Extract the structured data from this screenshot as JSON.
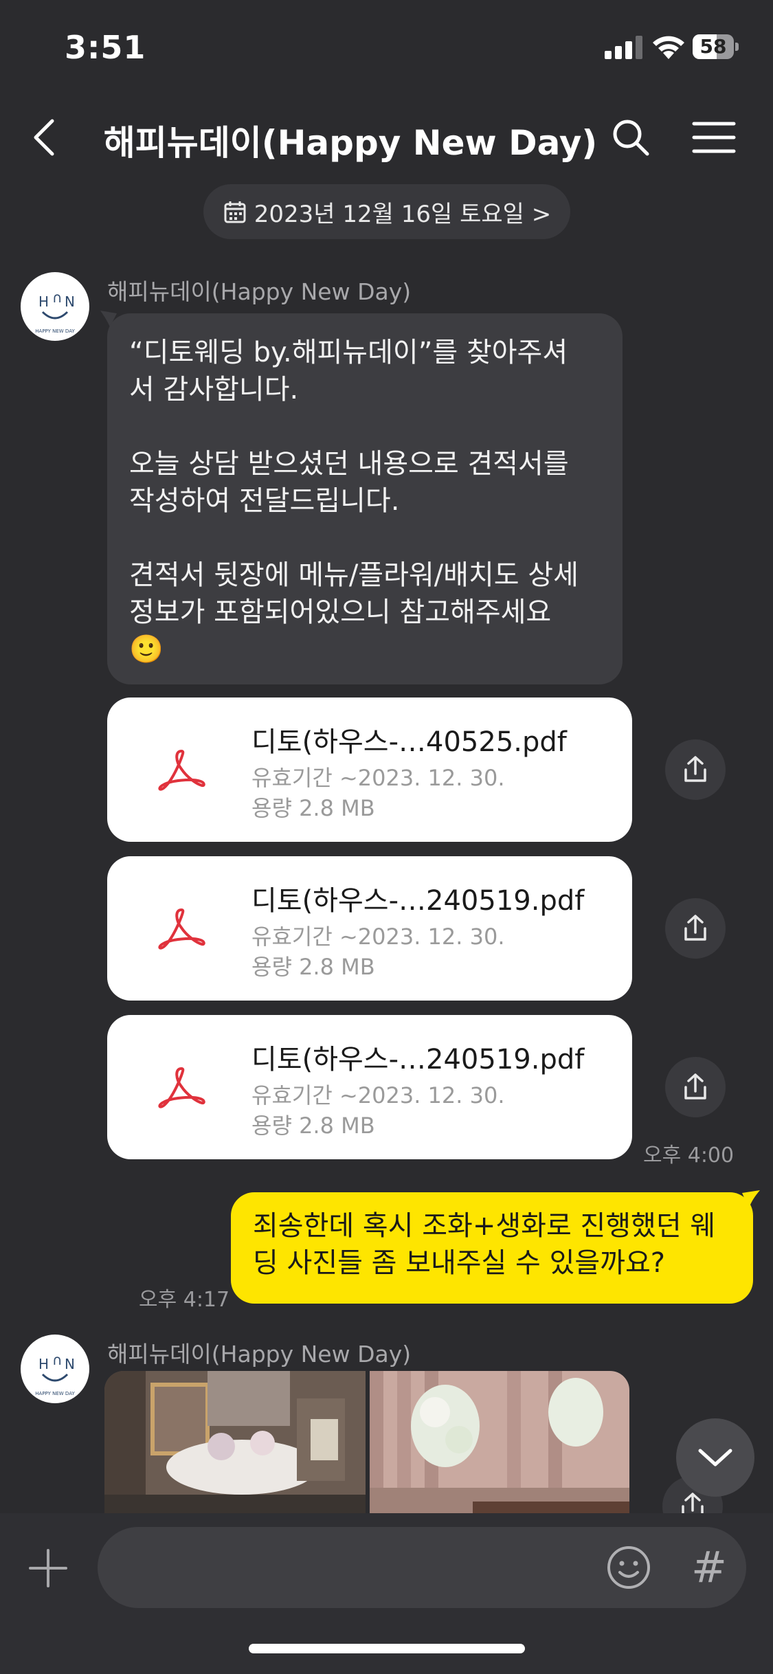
{
  "status": {
    "time": "3:51",
    "battery": "58",
    "battery_level": 0.58
  },
  "header": {
    "title": "해피뉴데이(Happy New Day)"
  },
  "date_chip": {
    "label": "2023년 12월 16일 토요일 >"
  },
  "chat": {
    "sender_name": "해피뉴데이(Happy New Day)",
    "avatar_text": "HAPPY NEW DAY",
    "message1": "“디토웨딩 by.해피뉴데이”를 찾아주셔\n서 감사합니다.\n\n오늘 상담 받으셨던 내용으로 견적서를\n작성하여 전달드립니다.\n\n견적서 뒷장에 메뉴/플라워/배치도 상세\n정보가 포함되어있으니 참고해주세요\n🙂",
    "files": [
      {
        "name": "디토(하우스-…40525.pdf",
        "expiry_label": "유효기간",
        "expiry": "~2023. 12. 30.",
        "size_label": "용량",
        "size": "2.8 MB"
      },
      {
        "name": "디토(하우스-…240519.pdf",
        "expiry_label": "유효기간",
        "expiry": "~2023. 12. 30.",
        "size_label": "용량",
        "size": "2.8 MB"
      },
      {
        "name": "디토(하우스-…240519.pdf",
        "expiry_label": "유효기간",
        "expiry": "~2023. 12. 30.",
        "size_label": "용량",
        "size": "2.8 MB"
      }
    ],
    "files_time": "오후 4:00",
    "outgoing": "죄송한데 혹시 조화+생화로 진행했던 웨\n딩 사진들 좀 보내주실 수 있을까요?",
    "outgoing_time": "오후 4:17",
    "sender_name2": "해피뉴데이(Happy New Day)"
  },
  "input": {
    "placeholder": "",
    "hash": "#"
  },
  "colors": {
    "background": "#2b2b2e",
    "outgoing_bubble": "#fee500",
    "incoming_bubble": "#3d3d41",
    "pdf_icon": "#e0323c"
  },
  "icons": [
    "back-icon",
    "search-icon",
    "menu-icon",
    "calendar-icon",
    "pdf-icon",
    "share-icon",
    "chevron-down-icon",
    "plus-icon",
    "emoji-icon"
  ]
}
